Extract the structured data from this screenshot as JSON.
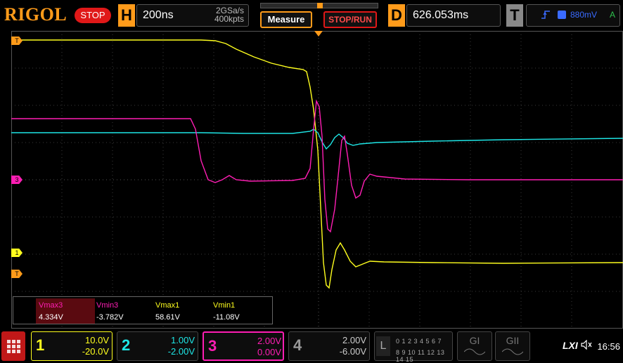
{
  "top": {
    "logo": "RIGOL",
    "run_state": "STOP",
    "horizontal_letter": "H",
    "timebase": "200ns",
    "sample_rate": "2GSa/s",
    "memory_depth": "400kpts",
    "measure_label": "Measure",
    "stoprun_label": "STOP/RUN",
    "delay_letter": "D",
    "delay_value": "626.053ms",
    "trigger_letter": "T",
    "trigger_level": "880mV",
    "trigger_mode": "A"
  },
  "markers": {
    "trigger_pos": "T",
    "ch1": "1",
    "ch3": "3",
    "trig": "T"
  },
  "measurements": [
    {
      "label": "Vmax3",
      "value": "4.334V"
    },
    {
      "label": "Vmin3",
      "value": "-3.782V"
    },
    {
      "label": "Vmax1",
      "value": "58.61V"
    },
    {
      "label": "Vmin1",
      "value": "-11.08V"
    }
  ],
  "channels": [
    {
      "num": "1",
      "scale": "10.0V",
      "offset": "-20.0V",
      "color": "#ffff1e"
    },
    {
      "num": "2",
      "scale": "1.00V",
      "offset": "-2.00V",
      "color": "#1ee6e6"
    },
    {
      "num": "3",
      "scale": "2.00V",
      "offset": "0.00V",
      "color": "#ff1eb4"
    },
    {
      "num": "4",
      "scale": "2.00V",
      "offset": "-6.00V",
      "color": "#999999"
    }
  ],
  "la": {
    "letter": "L",
    "row1": "0 1 2 3  4 5 6 7",
    "row2": "8 9 10 11 12 13 14 15"
  },
  "gen": {
    "g1": "GI",
    "g2": "GII"
  },
  "status": {
    "lxi": "LXI",
    "time": "16:56"
  },
  "colors": {
    "accent": "#ff9b1a",
    "stop": "#e01818",
    "trigger": "#3a6bff"
  },
  "icons": {
    "menu": "grid-menu-icon",
    "speaker": "speaker-icon",
    "trigger_edge": "rising-edge-icon"
  }
}
